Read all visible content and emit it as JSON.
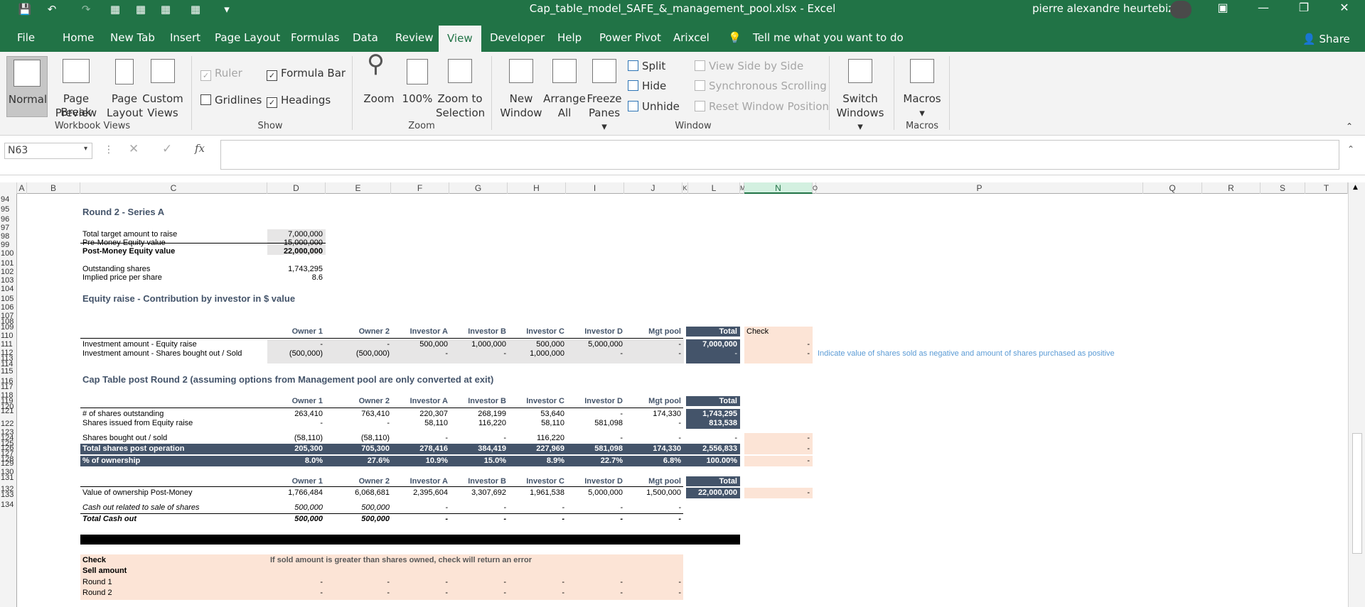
{
  "app": {
    "filename": "Cap_table_model_SAFE_&_management_pool.xlsx",
    "separator": "-",
    "app_name": "Excel",
    "user": "pierre alexandre heurtebize",
    "share": "Share"
  },
  "menu": [
    "File",
    "Home",
    "New Tab",
    "Insert",
    "Page Layout",
    "Formulas",
    "Data",
    "Review",
    "View",
    "Developer",
    "Help",
    "Power Pivot",
    "Arixcel"
  ],
  "active_tab": "View",
  "tell_me": "Tell me what you want to do",
  "ribbon": {
    "workbook_views": {
      "normal": "Normal",
      "page_break": "Page Break",
      "page_break2": "Preview",
      "page_layout": "Page",
      "page_layout2": "Layout",
      "custom": "Custom",
      "custom2": "Views",
      "group": "Workbook Views"
    },
    "show": {
      "ruler": "Ruler",
      "formula_bar": "Formula Bar",
      "gridlines": "Gridlines",
      "headings": "Headings",
      "group": "Show"
    },
    "zoom": {
      "zoom": "Zoom",
      "pct": "100%",
      "to_sel": "Zoom to",
      "to_sel2": "Selection",
      "group": "Zoom"
    },
    "window": {
      "new": "New",
      "new2": "Window",
      "arrange": "Arrange",
      "arrange2": "All",
      "freeze": "Freeze",
      "freeze2": "Panes",
      "split": "Split",
      "hide": "Hide",
      "unhide": "Unhide",
      "side": "View Side by Side",
      "sync": "Synchronous Scrolling",
      "reset": "Reset Window Position",
      "switch": "Switch",
      "switch2": "Windows",
      "group": "Window"
    },
    "macros": {
      "macros": "Macros",
      "group": "Macros"
    }
  },
  "namebox": "N63",
  "fx": "fx",
  "columns": [
    "A",
    "B",
    "C",
    "D",
    "E",
    "F",
    "G",
    "H",
    "I",
    "J",
    "K",
    "L",
    "M",
    "N",
    "O",
    "P",
    "Q",
    "R",
    "S",
    "T"
  ],
  "rows": [
    "94",
    "95",
    "96",
    "97",
    "98",
    "99",
    "100",
    "101",
    "102",
    "103",
    "104",
    "105",
    "106",
    "107",
    "108",
    "109",
    "110",
    "111",
    "112",
    "113",
    "114",
    "115",
    "116",
    "117",
    "118",
    "119",
    "120",
    "121",
    "122",
    "123",
    "124",
    "125",
    "126",
    "127",
    "128",
    "129",
    "130",
    "131",
    "132",
    "133",
    "134"
  ],
  "sheet": {
    "round2_title": "Round 2 - Series A",
    "target_label": "Total target amount to raise",
    "target": "7,000,000",
    "premoney_label": "Pre-Money Equity value",
    "premoney": "15,000,000",
    "postmoney_label": "Post-Money Equity value",
    "postmoney": "22,000,000",
    "outstanding_label": "Outstanding shares",
    "outstanding": "1,743,295",
    "price_label": "Implied price per share",
    "price": "8.6",
    "equity_title": "Equity raise - Contribution by investor in $ value",
    "headers": [
      "Owner 1",
      "Owner 2",
      "Investor A",
      "Investor B",
      "Investor C",
      "Investor D",
      "Mgt pool",
      "Total"
    ],
    "check": "Check",
    "inv_eq_label": "Investment amount - Equity raise",
    "inv_eq": [
      "-",
      "-",
      "500,000",
      "1,000,000",
      "500,000",
      "5,000,000",
      "-",
      "7,000,000",
      "-"
    ],
    "inv_sold_label": "Investment amount - Shares bought out / Sold",
    "inv_sold": [
      "(500,000)",
      "(500,000)",
      "-",
      "-",
      "1,000,000",
      "-",
      "-",
      "-",
      "-"
    ],
    "note": "Indicate value of shares sold as negative and amount of shares purchased as positive",
    "cap_title": "Cap Table post Round 2 (assuming options from Management pool are only converted at exit)",
    "shares_out_label": "# of shares outstanding",
    "shares_out": [
      "263,410",
      "763,410",
      "220,307",
      "268,199",
      "53,640",
      "-",
      "174,330",
      "1,743,295"
    ],
    "issued_label": "Shares issued from Equity raise",
    "issued": [
      "-",
      "-",
      "58,110",
      "116,220",
      "58,110",
      "581,098",
      "-",
      "813,538"
    ],
    "bought_label": "Shares bought out / sold",
    "bought": [
      "(58,110)",
      "(58,110)",
      "-",
      "-",
      "116,220",
      "-",
      "-",
      "-",
      "-"
    ],
    "total_shares_label": "Total shares post operation",
    "total_shares": [
      "205,300",
      "705,300",
      "278,416",
      "384,419",
      "227,969",
      "581,098",
      "174,330",
      "2,556,833",
      "-"
    ],
    "pct_label": "% of ownership",
    "pct": [
      "8.0%",
      "27.6%",
      "10.9%",
      "15.0%",
      "8.9%",
      "22.7%",
      "6.8%",
      "100.00%",
      "-"
    ],
    "value_label": "Value of ownership Post-Money",
    "value": [
      "1,766,484",
      "6,068,681",
      "2,395,604",
      "3,307,692",
      "1,961,538",
      "5,000,000",
      "1,500,000",
      "22,000,000",
      "-"
    ],
    "cash_label": "Cash out related to sale of shares",
    "cash": [
      "500,000",
      "500,000",
      "-",
      "-",
      "-",
      "-",
      "-"
    ],
    "total_cash_label": "Total Cash out",
    "total_cash": [
      "500,000",
      "500,000",
      "-",
      "-",
      "-",
      "-",
      "-"
    ],
    "check2_label": "Check",
    "check_note": "If sold amount is greater than shares owned, check will return an error",
    "sell_label": "Sell amount",
    "round1_label": "Round 1",
    "round1": [
      "-",
      "-",
      "-",
      "-",
      "-",
      "-",
      "-"
    ],
    "round2_label": "Round 2",
    "round2": [
      "-",
      "-",
      "-",
      "-",
      "-",
      "-",
      "-"
    ]
  },
  "colors": {
    "excel_green": "#217346",
    "header_navy": "#44546a",
    "check_fill": "#fce4d6",
    "input_gray": "#e7e6e6",
    "note_blue": "#5b9bd5"
  }
}
